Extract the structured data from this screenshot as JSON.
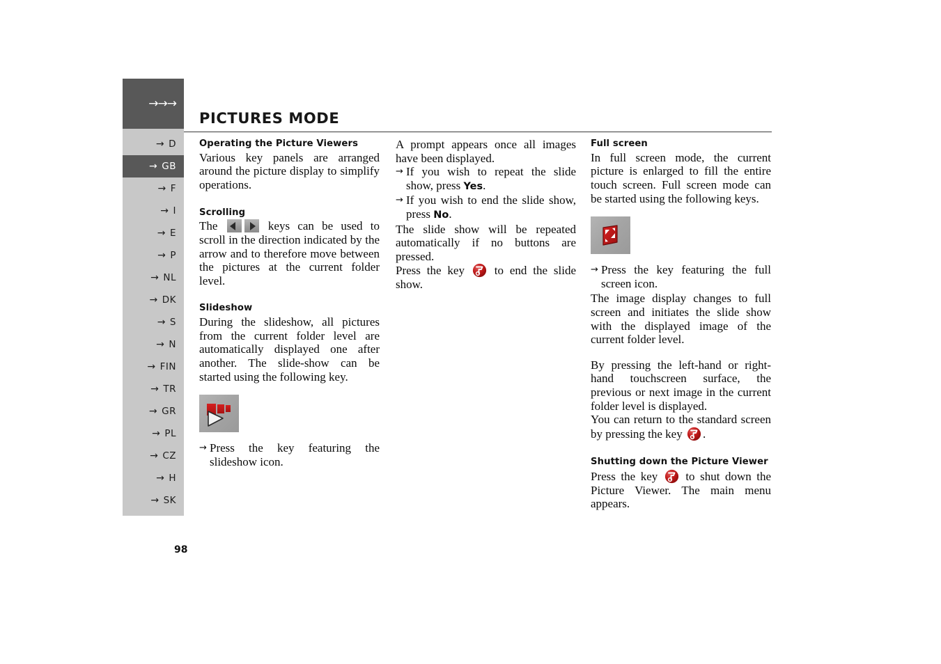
{
  "header": {
    "arrows": "→→→",
    "title": "PICTURES MODE"
  },
  "sidebar": {
    "items": [
      {
        "label": "D",
        "active": false
      },
      {
        "label": "GB",
        "active": true
      },
      {
        "label": "F",
        "active": false
      },
      {
        "label": "I",
        "active": false
      },
      {
        "label": "E",
        "active": false
      },
      {
        "label": "P",
        "active": false
      },
      {
        "label": "NL",
        "active": false
      },
      {
        "label": "DK",
        "active": false
      },
      {
        "label": "S",
        "active": false
      },
      {
        "label": "N",
        "active": false
      },
      {
        "label": "FIN",
        "active": false
      },
      {
        "label": "TR",
        "active": false
      },
      {
        "label": "GR",
        "active": false
      },
      {
        "label": "PL",
        "active": false
      },
      {
        "label": "CZ",
        "active": false
      },
      {
        "label": "H",
        "active": false
      },
      {
        "label": "SK",
        "active": false
      }
    ],
    "arrow_glyph": "→"
  },
  "column1": {
    "heading": "Operating the Picture Viewers",
    "intro": "Various key panels are arranged around the picture display to simplify operations.",
    "scrolling_heading": "Scrolling",
    "scrolling_text_before": "The",
    "scrolling_text_after": "keys can be used to scroll in the direction indicated by the arrow and to therefore move between the pictures at the current folder level.",
    "slideshow_heading": "Slideshow",
    "slideshow_text": "During the slideshow, all pictures from the current folder level are automatically displayed one after another. The slide-show can be started using the following key.",
    "slideshow_bullet": "Press the key featuring the slideshow icon."
  },
  "column2": {
    "prompt_text": "A prompt appears once all images have been displayed.",
    "bullet_repeat_before": "If you wish to repeat the slide show, press",
    "bullet_repeat_bold": "Yes",
    "bullet_end_before": "If you wish to end the slide show, press",
    "bullet_end_bold": "No",
    "auto_repeat_text": "The slide show will be repeated automatically if no buttons are pressed.",
    "end_text_before": "Press the key",
    "end_text_after": "to end the slide show."
  },
  "column3": {
    "fullscreen_heading": "Full screen",
    "fullscreen_text": "In full screen mode, the current picture is enlarged to fill the entire touch screen. Full screen mode can be started using the following keys.",
    "fullscreen_bullet": "Press the key featuring the full screen icon.",
    "changes_text": "The image display changes to full screen and initiates the slide show with the displayed image of the current folder level.",
    "touch_text": "By pressing the left-hand or right-hand touchscreen surface, the previous or next image in the current folder level is displayed.",
    "return_text_before": "You can return to the standard screen by pressing the key",
    "return_text_after": ".",
    "shutdown_heading": "Shutting down the Picture Viewer",
    "shutdown_before": "Press the key",
    "shutdown_after": "to shut down the Picture Viewer. The main menu appears."
  },
  "footer": {
    "page_number": "98"
  },
  "icons": {
    "slideshow_tile": "slideshow-icon",
    "fullscreen_tile": "fullscreen-icon",
    "exit_key": "exit-picture-viewer-icon",
    "scroll_left": "scroll-left-icon",
    "scroll_right": "scroll-right-icon"
  },
  "colors": {
    "sidebar_active": "#585858",
    "sidebar_bg": "#c8c8c8",
    "icon_red": "#c21a1a",
    "rule": "#3a3a3a"
  }
}
